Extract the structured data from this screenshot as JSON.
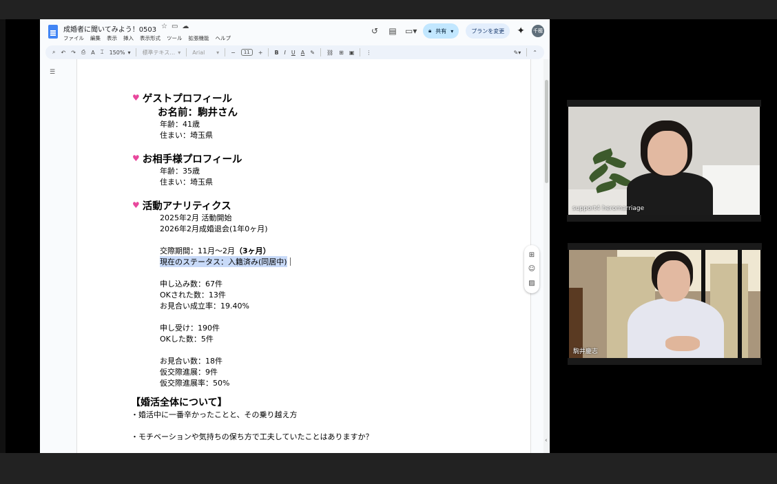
{
  "document": {
    "title": "成婚者に聞いてみよう！0503",
    "menu": [
      "ファイル",
      "編集",
      "表示",
      "挿入",
      "表示形式",
      "ツール",
      "拡張機能",
      "ヘルプ"
    ],
    "share_label": "共有",
    "plan_label": "プランを変更",
    "user_initials": "千穂"
  },
  "toolbar": {
    "zoom": "150%",
    "style": "標準テキス…",
    "font": "Arial",
    "font_size": "11"
  },
  "content": {
    "guest_heading": "ゲストプロフィール",
    "guest_name": "お名前：駒井さん",
    "guest_age": "年齢：41歳",
    "guest_residence": "住まい：埼玉県",
    "partner_heading": "お相手様プロフィール",
    "partner_age": "年齢：35歳",
    "partner_residence": "住まい：埼玉県",
    "analytics_heading": "活動アナリティクス",
    "activity_start": "2025年2月 活動開始",
    "withdrawal": "2026年2月成婚退会(1年0ヶ月)",
    "dating_period_prefix": "交際期間：11月～2月",
    "dating_period_bold": "（3ヶ月）",
    "status": "現在のステータス：入籍済み(同居中)",
    "applications": "申し込み数：67件",
    "ok_received": "OKされた数：13件",
    "meeting_rate": "お見合い成立率：19.40%",
    "received": "申し受け：190件",
    "ok_given": "OKした数：5件",
    "meetings": "お見合い数：18件",
    "provisional": "仮交際進展：9件",
    "provisional_rate": "仮交際進展率：50%",
    "section_title": "【婚活全体について】",
    "q1": "・婚活中に一番辛かったことと、その乗り越え方",
    "q2": "・モチベーションや気持ちの保ち方で工夫していたことはありますか？"
  },
  "participants": [
    {
      "name": "support4 heromarriage"
    },
    {
      "name": "駒井慶志"
    }
  ],
  "colors": {
    "heart": "#e8479c",
    "highlight": "#c8daf8",
    "share_button": "#c2e7ff",
    "docs_blue": "#4285f4"
  },
  "icons": [
    "docs-logo-icon",
    "star-icon",
    "folder-icon",
    "cloud-icon",
    "history-icon",
    "comment-icon",
    "video-icon",
    "lock-icon",
    "sparkle-icon",
    "search-icon",
    "undo-icon",
    "redo-icon",
    "print-icon",
    "spellcheck-icon",
    "paint-format-icon",
    "bold-icon",
    "italic-icon",
    "underline-icon",
    "text-color-icon",
    "highlight-icon",
    "link-icon",
    "insert-comment-icon",
    "image-icon",
    "more-icon",
    "pen-icon",
    "collapse-icon",
    "outline-icon",
    "add-comment-icon",
    "emoji-icon",
    "suggest-icon"
  ]
}
